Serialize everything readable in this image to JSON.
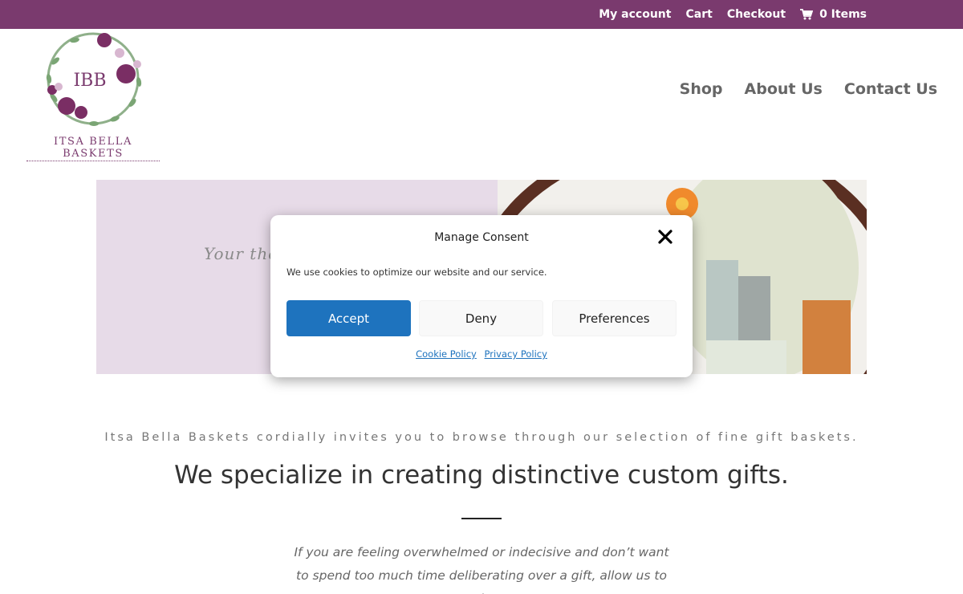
{
  "topbar": {
    "links": [
      "My account",
      "Cart",
      "Checkout"
    ],
    "cart_label": "0 Items"
  },
  "logo": {
    "initials": "IBB",
    "name": "ITSA BELLA BASKETS"
  },
  "nav": {
    "items": [
      "Shop",
      "About Us",
      "Contact Us"
    ]
  },
  "banner": {
    "text": "Your tho"
  },
  "consent": {
    "title": "Manage Consent",
    "message": "We use cookies to optimize our website and our service.",
    "accept_label": "Accept",
    "deny_label": "Deny",
    "preferences_label": "Preferences",
    "cookie_policy_label": "Cookie Policy",
    "privacy_policy_label": "Privacy Policy"
  },
  "content": {
    "intro": "Itsa Bella Baskets cordially invites you to browse through our selection of fine gift baskets.",
    "headline": "We specialize in creating distinctive custom gifts.",
    "body": "If you are feeling overwhelmed or indecisive and don’t want to spend too much time deliberating over a gift, allow us to take"
  },
  "colors": {
    "brand": "#7a3a6e",
    "accept": "#1e73be"
  }
}
